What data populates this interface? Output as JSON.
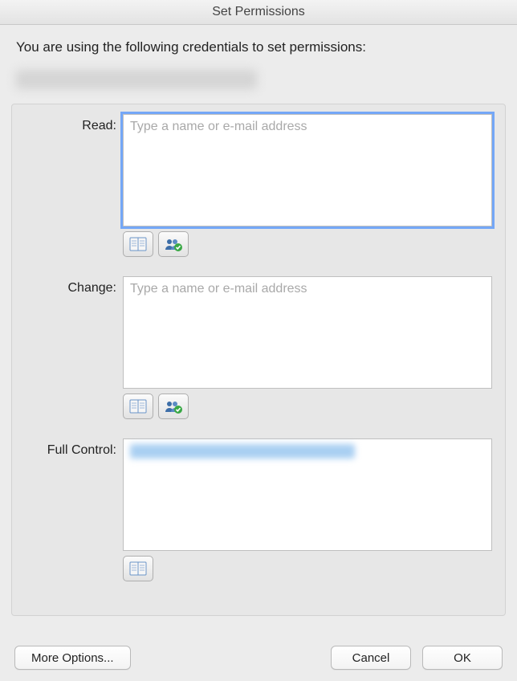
{
  "window": {
    "title": "Set Permissions"
  },
  "intro": "You are using the following credentials to set permissions:",
  "credential_display": "",
  "fields": {
    "read": {
      "label": "Read:",
      "placeholder": "Type a name or e-mail address",
      "value": "",
      "focused": true,
      "show_addressbook": true,
      "show_checknames": true
    },
    "change": {
      "label": "Change:",
      "placeholder": "Type a name or e-mail address",
      "value": "",
      "focused": false,
      "show_addressbook": true,
      "show_checknames": true
    },
    "full": {
      "label": "Full Control:",
      "placeholder": "",
      "value_redacted": true,
      "focused": false,
      "show_addressbook": true,
      "show_checknames": false
    }
  },
  "buttons": {
    "more_options": "More Options...",
    "cancel": "Cancel",
    "ok": "OK"
  },
  "icons": {
    "addressbook": "address-book-icon",
    "checknames": "check-names-icon"
  }
}
